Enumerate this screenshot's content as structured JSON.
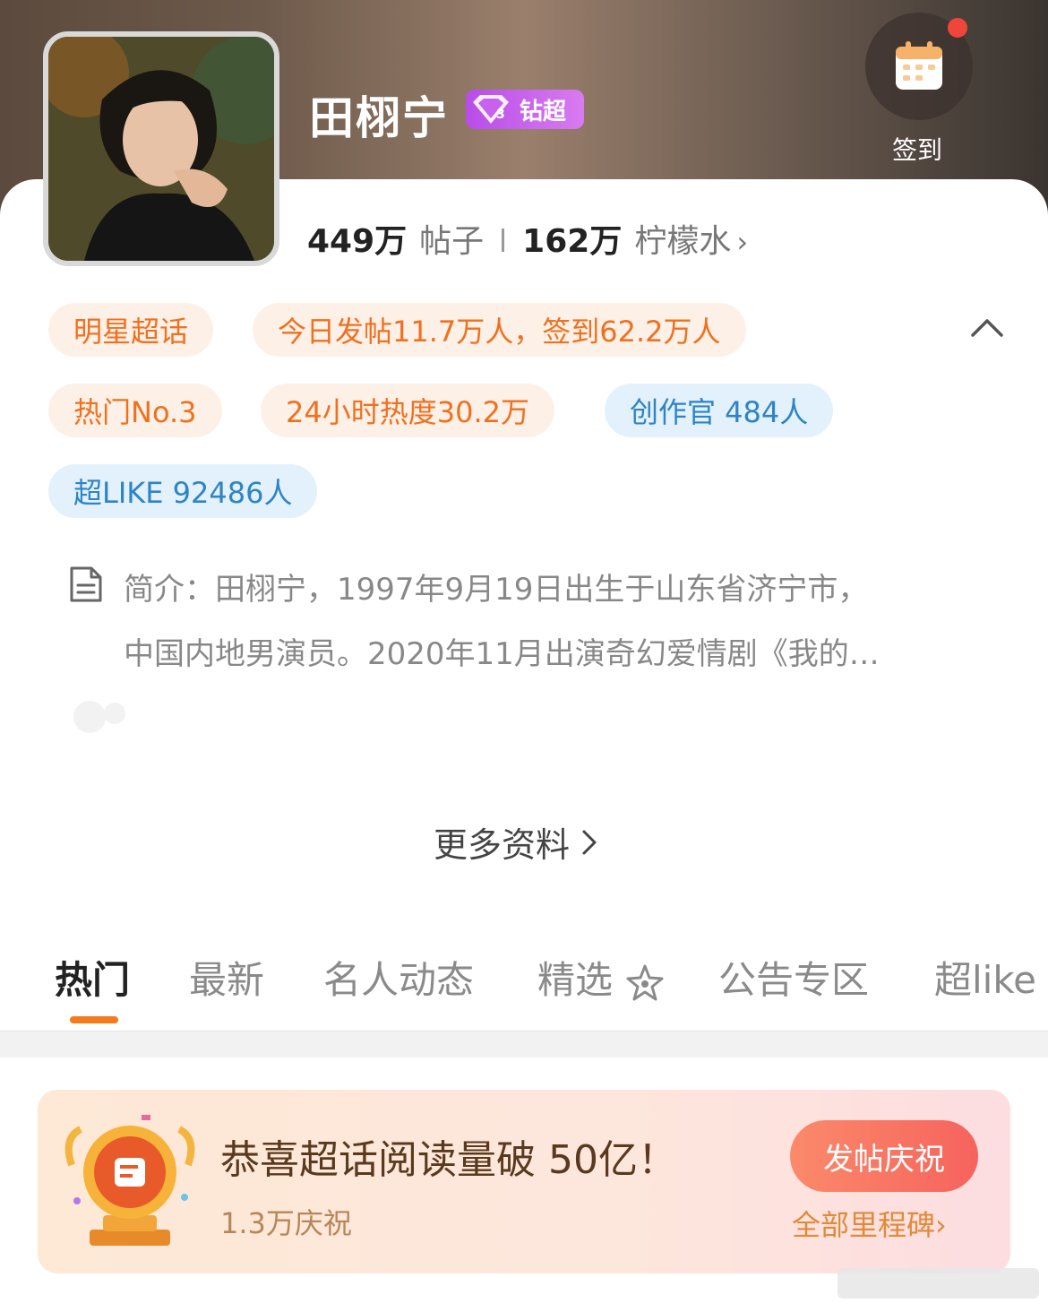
{
  "profile": {
    "name": "田栩宁",
    "badge_label": "钻超",
    "posts_count": "449万",
    "posts_label": "帖子",
    "fans_count": "162万",
    "fans_label": "柠檬水",
    "fans_chevron": "›"
  },
  "checkin": {
    "label": "签到",
    "icon": "calendar-icon",
    "has_notification": true
  },
  "tags": {
    "row1": [
      "明星超话",
      "今日发帖11.7万人，签到62.2万人"
    ],
    "row2": [
      "热门No.3",
      "24小时热度30.2万",
      "创作官 484人"
    ],
    "row3": [
      "超LIKE 92486人"
    ]
  },
  "intro": {
    "line1": "简介：田栩宁，1997年9月19日出生于山东省济宁市，",
    "line2": "中国内地男演员。2020年11月出演奇幻爱情剧《我的…"
  },
  "more_info": {
    "label": "更多资料",
    "chevron": "›"
  },
  "tabs": [
    {
      "label": "热门",
      "active": true
    },
    {
      "label": "最新",
      "active": false
    },
    {
      "label": "名人动态",
      "active": false
    },
    {
      "label": "精选",
      "active": false
    },
    {
      "label": "公告专区",
      "active": false
    },
    {
      "label": "超like",
      "active": false
    }
  ],
  "milestone_banner": {
    "title": "恭喜超话阅读量破 50亿！",
    "sub": "1.3万庆祝",
    "button": "发帖庆祝",
    "all_link": "全部里程碑›"
  },
  "colors": {
    "accent": "#f47a1e",
    "tag_orange_bg": "#fdf0e7",
    "tag_blue_bg": "#e2f1fb",
    "badge_purple": "#b84de8"
  }
}
